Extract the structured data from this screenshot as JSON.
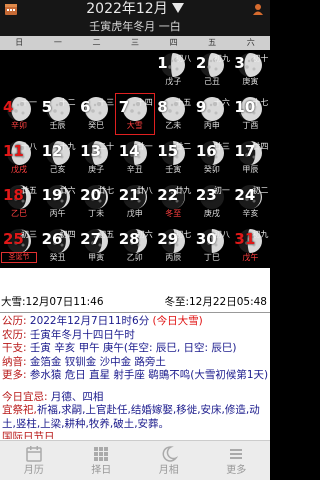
{
  "header": {
    "month_title": "2022年12月",
    "lunar_title": "壬寅虎年冬月 一白",
    "icons": [
      "calendar-icon",
      "triangle-down-icon",
      "user-icon"
    ]
  },
  "weekdays": [
    "日",
    "一",
    "二",
    "三",
    "四",
    "五",
    "六"
  ],
  "grid": {
    "rows": [
      [
        {
          "col": 4,
          "day": "1",
          "lunar": "初八",
          "gz": "戊子",
          "red": false,
          "phase": 0.58
        },
        {
          "col": 5,
          "day": "2",
          "lunar": "初九",
          "gz": "己丑",
          "red": false,
          "phase": 0.66
        },
        {
          "col": 6,
          "day": "3",
          "lunar": "初十",
          "gz": "庚寅",
          "red": false,
          "phase": 0.74
        }
      ],
      [
        {
          "col": 0,
          "day": "4",
          "lunar": "十一",
          "gz": "辛卯",
          "red": true,
          "phase": 0.82
        },
        {
          "col": 1,
          "day": "5",
          "lunar": "十二",
          "gz": "壬辰",
          "red": false,
          "phase": 0.9
        },
        {
          "col": 2,
          "day": "6",
          "lunar": "十三",
          "gz": "癸巳",
          "red": false,
          "phase": 0.96
        },
        {
          "col": 3,
          "day": "7",
          "lunar": "十四",
          "gz": "大雪",
          "red": false,
          "phase": 1.0,
          "gzred": true,
          "selected": true
        },
        {
          "col": 4,
          "day": "8",
          "lunar": "十五",
          "gz": "乙未",
          "red": false,
          "phase": 1.0
        },
        {
          "col": 5,
          "day": "9",
          "lunar": "十六",
          "gz": "丙申",
          "red": false,
          "phase": 0.96
        },
        {
          "col": 6,
          "day": "10",
          "lunar": "十七",
          "gz": "丁酉",
          "red": false,
          "phase": 0.9
        }
      ],
      [
        {
          "col": 0,
          "day": "11",
          "lunar": "十八",
          "gz": "戊戌",
          "red": true,
          "phase": 0.82
        },
        {
          "col": 1,
          "day": "12",
          "lunar": "十九",
          "gz": "己亥",
          "red": false,
          "phase": 0.74
        },
        {
          "col": 2,
          "day": "13",
          "lunar": "二十",
          "gz": "庚子",
          "red": false,
          "phase": 0.66
        },
        {
          "col": 3,
          "day": "14",
          "lunar": "廿一",
          "gz": "辛丑",
          "red": false,
          "phase": 0.56
        },
        {
          "col": 4,
          "day": "15",
          "lunar": "廿二",
          "gz": "壬寅",
          "red": false,
          "phase": 0.48
        },
        {
          "col": 5,
          "day": "16",
          "lunar": "廿三",
          "gz": "癸卯",
          "red": false,
          "phase": 0.38
        },
        {
          "col": 6,
          "day": "17",
          "lunar": "廿四",
          "gz": "甲辰",
          "red": false,
          "phase": 0.28
        }
      ],
      [
        {
          "col": 0,
          "day": "18",
          "lunar": "廿五",
          "gz": "乙巳",
          "red": true,
          "phase": 0.2
        },
        {
          "col": 1,
          "day": "19",
          "lunar": "廿六",
          "gz": "丙午",
          "red": false,
          "phase": 0.13
        },
        {
          "col": 2,
          "day": "20",
          "lunar": "廿七",
          "gz": "丁未",
          "red": false,
          "phase": 0.08
        },
        {
          "col": 3,
          "day": "21",
          "lunar": "廿八",
          "gz": "戊申",
          "red": false,
          "phase": 0.05
        },
        {
          "col": 4,
          "day": "22",
          "lunar": "廿九",
          "gz": "冬至",
          "red": false,
          "phase": 0.02,
          "gzred": true
        },
        {
          "col": 5,
          "day": "23",
          "lunar": "初一",
          "gz": "庚戌",
          "red": false,
          "phase": 0.0
        },
        {
          "col": 6,
          "day": "24",
          "lunar": "初二",
          "gz": "辛亥",
          "red": false,
          "phase": 0.05
        }
      ],
      [
        {
          "col": 0,
          "day": "25",
          "lunar": "初三",
          "gz": "圣诞节",
          "red": true,
          "phase": 0.1,
          "fest": true
        },
        {
          "col": 1,
          "day": "26",
          "lunar": "初四",
          "gz": "癸丑",
          "red": false,
          "phase": 0.17
        },
        {
          "col": 2,
          "day": "27",
          "lunar": "初五",
          "gz": "甲寅",
          "red": false,
          "phase": 0.25
        },
        {
          "col": 3,
          "day": "28",
          "lunar": "初六",
          "gz": "乙卯",
          "red": false,
          "phase": 0.34
        },
        {
          "col": 4,
          "day": "29",
          "lunar": "初七",
          "gz": "丙辰",
          "red": false,
          "phase": 0.43
        },
        {
          "col": 5,
          "day": "30",
          "lunar": "初八",
          "gz": "丁巳",
          "red": false,
          "phase": 0.52
        },
        {
          "col": 6,
          "day": "31",
          "lunar": "初九",
          "gz": "戊午",
          "red": true,
          "phase": 0.6
        }
      ]
    ]
  },
  "info": {
    "daxue": "大雪:12月07日11:46",
    "dongzhi": "冬至:12月22日05:48",
    "gongli_label": "公历:",
    "gongli_value": "2022年12月7日11时6分",
    "gongli_today": "(今日大雪)",
    "nongli_label": "农历:",
    "nongli_value": "壬寅年冬月十四日午时",
    "ganzhi_label": "干支:",
    "ganzhi_value": "壬寅 辛亥 甲午 庚午(年空: 辰巳, 日空: 辰巳)",
    "nayin_label": "纳音:",
    "nayin_value": "金箔金 钗钏金 沙中金 路旁土",
    "gengduo_label": "更多:",
    "gengduo_value": "参水猿 危日 直星 射手座 鹖鴠不鸣(大雪初候第1天)",
    "today_label": "今日宜忌:",
    "today_value": "月德、四相",
    "yi_label": "宜祭祀,",
    "yi_value": "祈福,求嗣,上官赴任,结婚嫁娶,移徙,安床,修造,动土,竖柱,上梁,耕种,牧养,破土,安葬。",
    "more_label": "国际日节日"
  },
  "tabs": [
    {
      "label": "月历",
      "icon": "calendar-icon"
    },
    {
      "label": "择日",
      "icon": "grid-icon"
    },
    {
      "label": "月相",
      "icon": "moon-icon"
    },
    {
      "label": "更多",
      "icon": "menu-icon"
    }
  ]
}
